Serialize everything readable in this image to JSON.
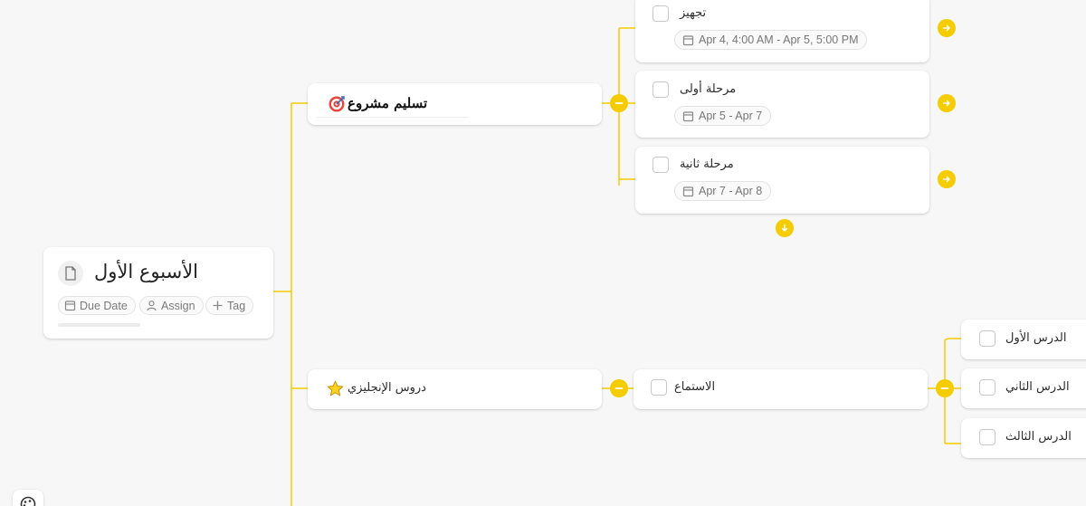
{
  "colors": {
    "accent": "#f5cc00",
    "background": "#f7f7f7",
    "card": "#ffffff"
  },
  "root": {
    "title": "الأسبوع الأول",
    "icon": "document-icon",
    "chips": {
      "due_date": "Due Date",
      "assign": "Assign",
      "tag": "Tag"
    }
  },
  "branches": {
    "project": {
      "title": "تسليم مشروع",
      "icon": "target-icon"
    },
    "english": {
      "title": "دروس الإنجليزي",
      "icon": "star-icon"
    }
  },
  "tasks": [
    {
      "label": "تجهيز",
      "date": "Apr 4, 4:00 AM - Apr 5, 5:00 PM"
    },
    {
      "label": "مرحلة أولى",
      "date": "Apr 5 - Apr 7"
    },
    {
      "label": "مرحلة ثانية",
      "date": "Apr 7 - Apr 8"
    }
  ],
  "listening": {
    "label": "الاستماع"
  },
  "lessons": [
    {
      "label": "الدرس الأول"
    },
    {
      "label": "الدرس الثاني"
    },
    {
      "label": "الدرس الثالث"
    }
  ]
}
